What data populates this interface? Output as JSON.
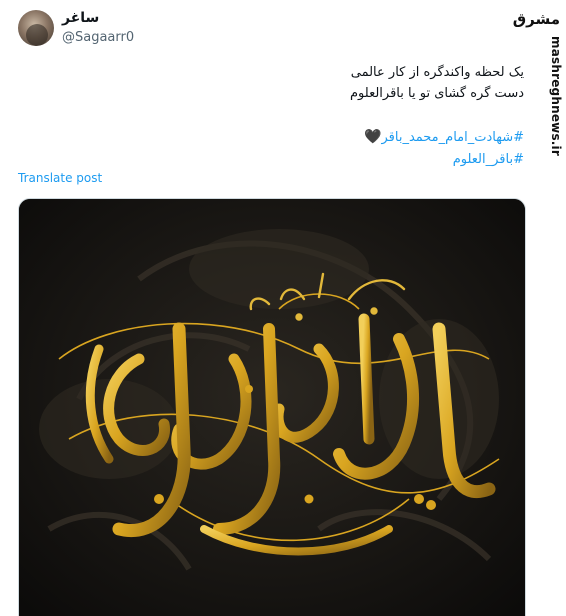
{
  "author": {
    "display_name": "ساغر",
    "handle": "@Sagaarr0"
  },
  "post": {
    "lines": [
      "یک لحظه واکندگره از کار عالمی",
      "دست گره گشای تو یا باقرالعلوم"
    ],
    "hashtags": [
      "#شهادت_امام_محمد_باقر",
      "#باقر_العلوم"
    ],
    "hashtag_emoji": "heart-black",
    "translate_label": "Translate post"
  },
  "media": {
    "calligraphy": {
      "line_main": "یا محمد بن علی الباقر",
      "line_top": "علیه السلام"
    },
    "colors": {
      "background": "#141312",
      "gold": "#d9a520",
      "gold_dark": "#6b5320"
    }
  },
  "watermark": {
    "logo": "مشرق",
    "url": "mashreghnews.ir"
  },
  "colors": {
    "link": "#1d9bf0",
    "text": "#0f1419",
    "muted": "#536471"
  }
}
